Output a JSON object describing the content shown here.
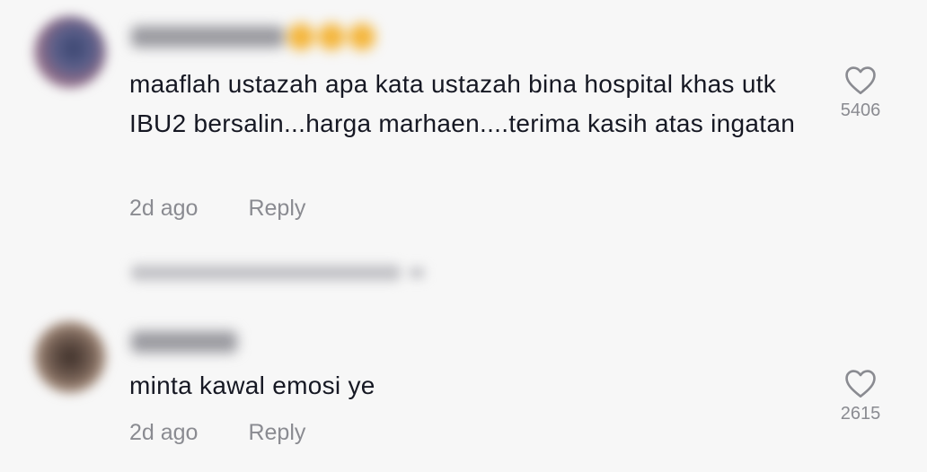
{
  "comments": [
    {
      "text": "maaflah ustazah apa kata ustazah bina hospital khas utk IBU2 bersalin...harga marhaen....terima kasih atas ingatan",
      "time": "2d ago",
      "reply_label": "Reply",
      "likes": "5406"
    },
    {
      "text": "minta kawal emosi ye",
      "time": "2d ago",
      "reply_label": "Reply",
      "likes": "2615"
    }
  ],
  "icons": {
    "like": "heart-outline-icon",
    "view_replies_chevron": "chevron-down-icon"
  },
  "colors": {
    "background": "#f7f7f7",
    "text": "#161823",
    "muted": "#8a8b91"
  }
}
